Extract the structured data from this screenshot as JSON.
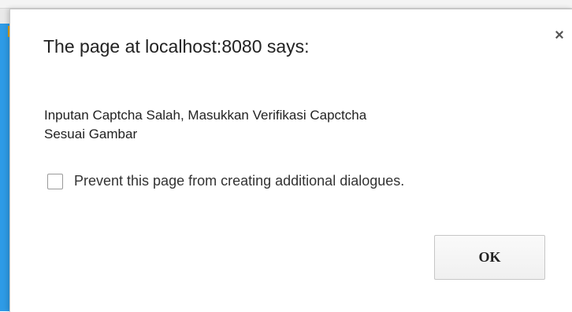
{
  "dialog": {
    "title": "The page at localhost:8080 says:",
    "message_line1": "Inputan Captcha Salah, Masukkan Verifikasi Capctcha",
    "message_line2": "Sesuai Gambar",
    "checkbox_label": "Prevent this page from creating additional dialogues.",
    "checkbox_checked": false,
    "ok_label": "OK",
    "close_glyph": "×",
    "close_icon": "close-icon"
  },
  "colors": {
    "side_accent": "#2e9be6",
    "dialog_background": "#ffffff",
    "text": "#222222"
  }
}
